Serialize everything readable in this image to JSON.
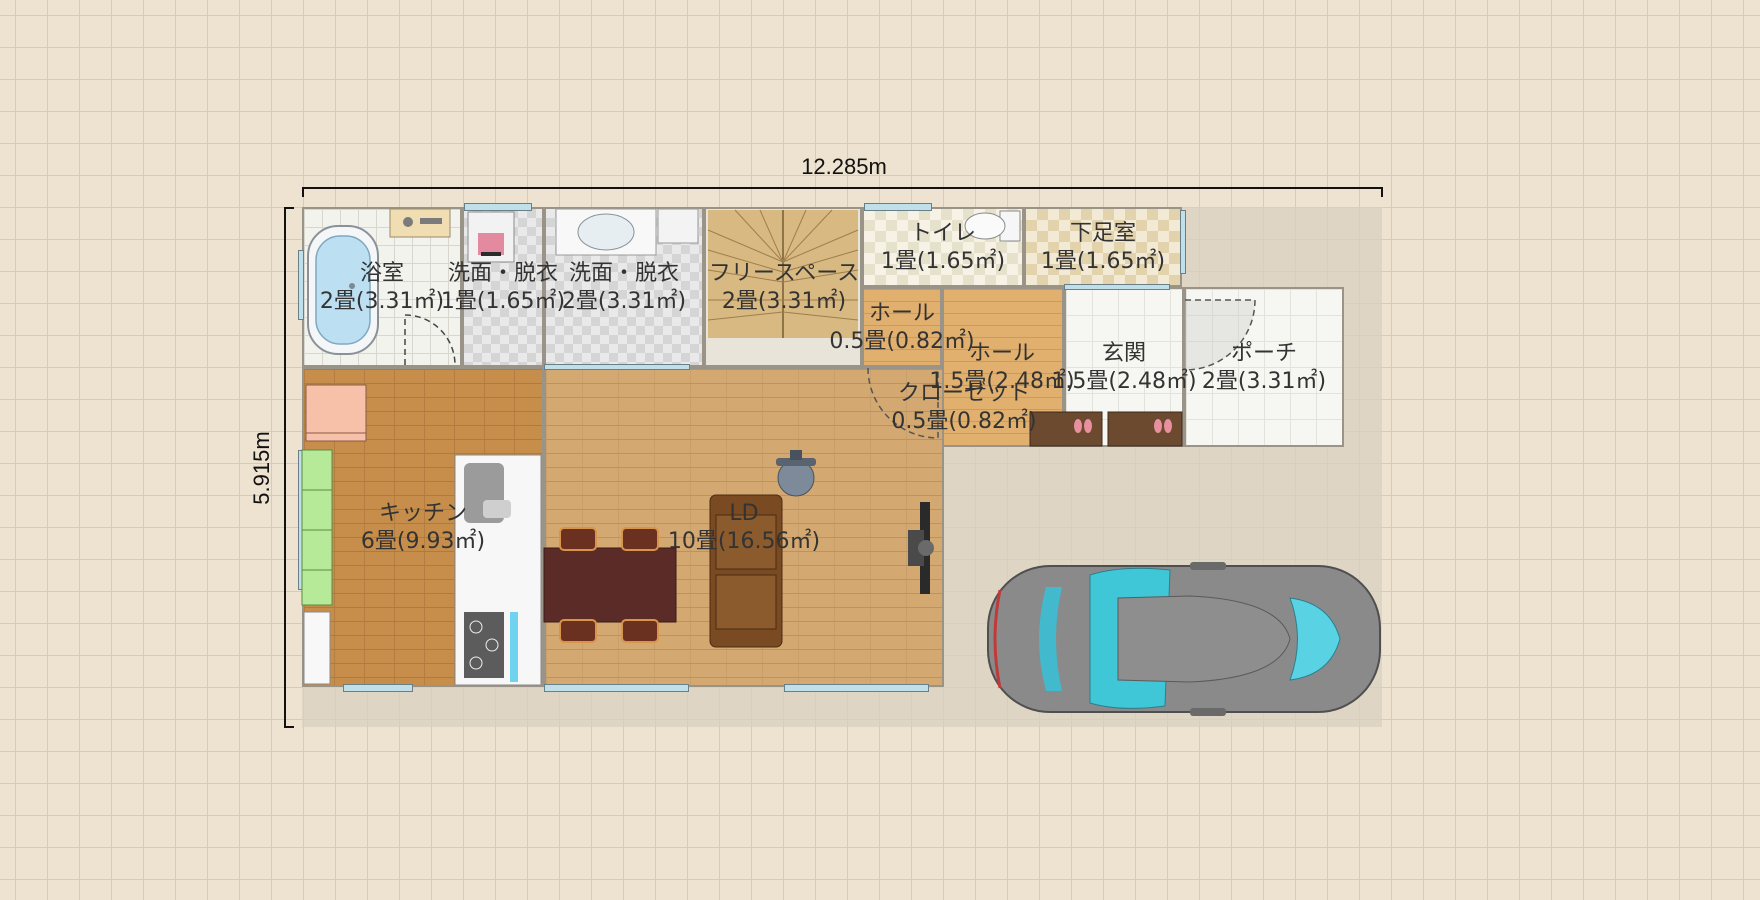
{
  "dimensions": {
    "width_label": "12.285m",
    "height_label": "5.915m"
  },
  "rooms": [
    {
      "name": "浴室",
      "area": "2畳(3.31㎡)"
    },
    {
      "name": "洗面・脱衣",
      "area": "1畳(1.65㎡)"
    },
    {
      "name": "洗面・脱衣",
      "area": "2畳(3.31㎡)"
    },
    {
      "name": "フリースペース",
      "area": "2畳(3.31㎡)"
    },
    {
      "name": "トイレ",
      "area": "1畳(1.65㎡)"
    },
    {
      "name": "下足室",
      "area": "1畳(1.65㎡)"
    },
    {
      "name": "ホール",
      "area": "0.5畳(0.82㎡)"
    },
    {
      "name": "ホール",
      "area": "1.5畳(2.48㎡)"
    },
    {
      "name": "玄関",
      "area": "1.5畳(2.48㎡)"
    },
    {
      "name": "ポーチ",
      "area": "2畳(3.31㎡)"
    },
    {
      "name": "クローゼット",
      "area": "0.5畳(0.82㎡)"
    },
    {
      "name": "キッチン",
      "area": "6畳(9.93㎡)"
    },
    {
      "name": "LD",
      "area": "10畳(16.56㎡)"
    }
  ],
  "colors": {
    "background": "#ede3d0",
    "wall": "#9a9488",
    "window": "#bfe0ea",
    "car_body": "#8a8a8a",
    "car_glass": "#3fc7d8"
  },
  "icons": [
    "bathtub-icon",
    "shower-icon",
    "washing-machine-icon",
    "sink-icon",
    "toilet-icon",
    "stairs-icon",
    "fridge-icon",
    "kitchen-counter-icon",
    "stove-icon",
    "dining-table-icon",
    "chair-icon",
    "sofa-icon",
    "tv-icon",
    "office-chair-icon",
    "slippers-icon",
    "car-icon",
    "door-swing-icon"
  ]
}
